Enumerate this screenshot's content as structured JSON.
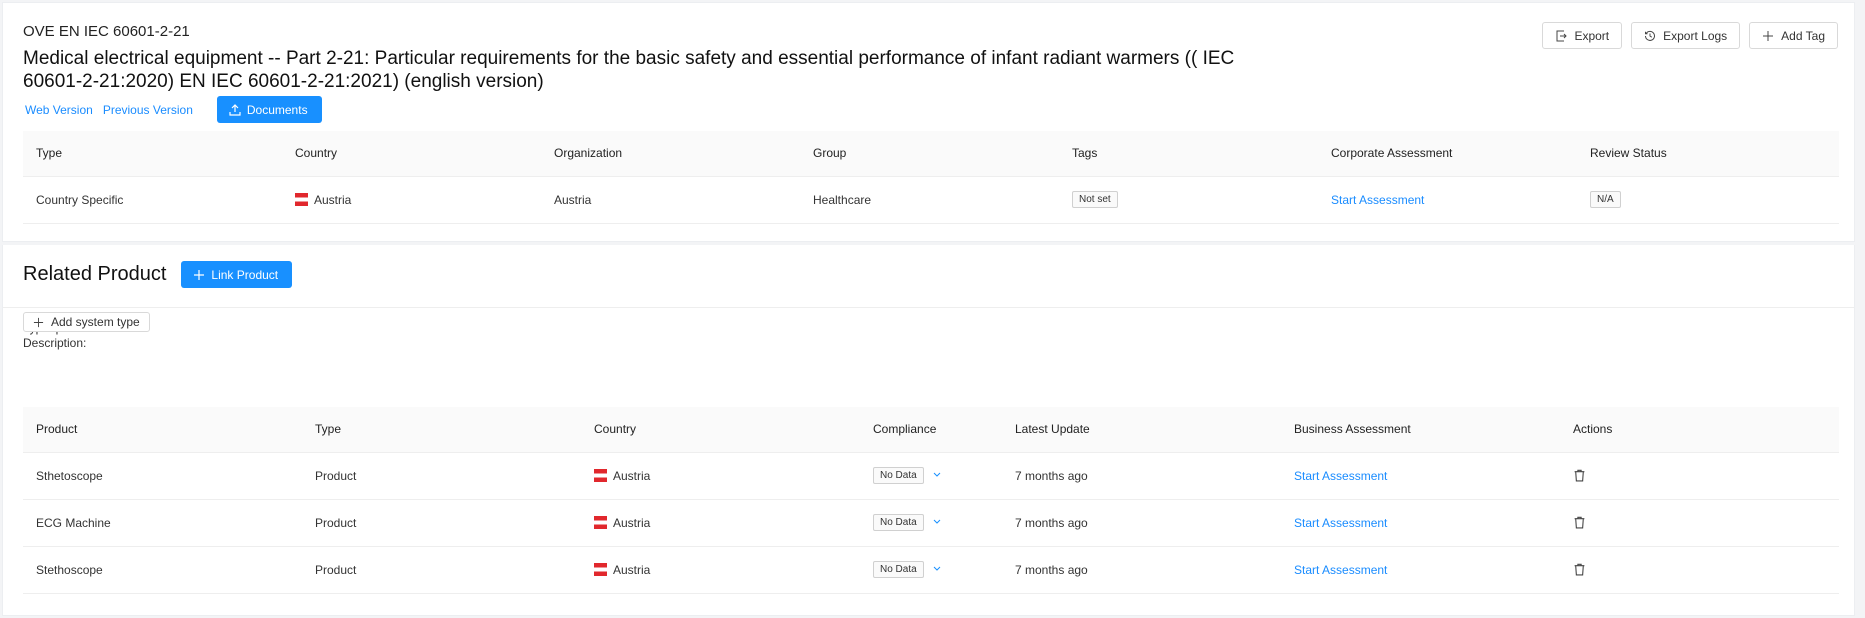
{
  "header": {
    "code": "OVE EN IEC 60601-2-21",
    "title": "Medical electrical equipment -- Part 2-21: Particular requirements for the basic safety and essential performance of infant radiant warmers (( IEC 60601-2-21:2020) EN IEC 60601-2-21:2021) (english version)",
    "web_version": "Web Version",
    "previous_version": "Previous Version",
    "documents_label": "Documents",
    "actions": {
      "export": "Export",
      "export_logs": "Export Logs",
      "add_tag": "Add Tag"
    }
  },
  "meta_table": {
    "headers": [
      "Type",
      "Country",
      "Organization",
      "Group",
      "Tags",
      "Corporate Assessment",
      "Review Status"
    ],
    "row": {
      "type": "Country Specific",
      "country": "Austria",
      "organization": "Austria",
      "group": "Healthcare",
      "tags": "Not set",
      "corporate_assessment": "Start Assessment",
      "review_status": "N/A"
    }
  },
  "related": {
    "title": "Related Product",
    "link_product": "Link Product",
    "type_line": "Type: product",
    "description_line": "Description:",
    "add_system_type": "Add system type",
    "headers": [
      "Product",
      "Type",
      "Country",
      "Compliance",
      "Latest Update",
      "Business Assessment",
      "Actions"
    ],
    "rows": [
      {
        "product": "Sthetoscope",
        "type": "Product",
        "country": "Austria",
        "compliance": "No Data",
        "latest_update": "7 months ago",
        "assessment": "Start Assessment"
      },
      {
        "product": "ECG Machine",
        "type": "Product",
        "country": "Austria",
        "compliance": "No Data",
        "latest_update": "7 months ago",
        "assessment": "Start Assessment"
      },
      {
        "product": "Stethoscope",
        "type": "Product",
        "country": "Austria",
        "compliance": "No Data",
        "latest_update": "7 months ago",
        "assessment": "Start Assessment"
      }
    ]
  },
  "colors": {
    "primary": "#1890ff",
    "link": "#1a8cff",
    "flag_red": "#e1282d"
  }
}
